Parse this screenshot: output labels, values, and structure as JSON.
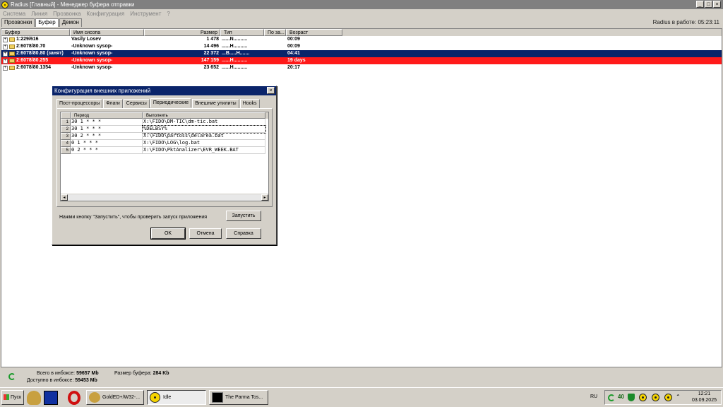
{
  "window": {
    "title": "Radius [Главный] - Менеджер буфера отправки",
    "min_label": "_",
    "max_label": "□",
    "close_label": "×"
  },
  "menu": [
    "Система",
    "Линия",
    "Прозвонка",
    "Конфигурация",
    "Инструмент",
    "?"
  ],
  "tabs": [
    "Прозвонки",
    "Буфер",
    "Демон"
  ],
  "uptime": "Radius в работе: 05:23:11",
  "table": {
    "headers": [
      "Буфер",
      "Имя сисопа",
      "Размер",
      "Тип",
      "По за...",
      "Возраст"
    ],
    "rows": [
      {
        "buffer": "1:229/616",
        "name": "Vasily Losev",
        "size": "1 478",
        "type": "......N..........",
        "age": "00:09",
        "state": "normal"
      },
      {
        "buffer": "2:6078/80.70",
        "name": "-Unknown sysop-",
        "size": "14 496",
        "type": "......H..........",
        "age": "00:09",
        "state": "normal"
      },
      {
        "buffer": "2:6078/80.80 (занят)",
        "name": "-Unknown sysop-",
        "size": "22 372",
        "type": "...B.....H.......",
        "age": "04:41",
        "state": "selected"
      },
      {
        "buffer": "2:6078/80.255",
        "name": "-Unknown sysop-",
        "size": "147 159",
        "type": "......H..........",
        "age": "19 days",
        "state": "red"
      },
      {
        "buffer": "2:6078/80.1354",
        "name": "-Unknown sysop-",
        "size": "23 652",
        "type": "......H..........",
        "age": "20:17",
        "state": "normal"
      }
    ]
  },
  "status": {
    "inbox_total_label": "Всего в инбоксе:",
    "inbox_total_value": "59657 Mb",
    "buffer_size_label": "Размер буфера:",
    "buffer_size_value": "284 Kb",
    "inbox_free_label": "Доступно в инбоксе:",
    "inbox_free_value": "59453 Mb"
  },
  "dialog": {
    "title": "Конфигурация внешних приложений",
    "close_label": "×",
    "tabs": [
      "Пост-процессоры",
      "Флаги",
      "Сервисы",
      "Периодические",
      "Внешние утилиты",
      "Hooks"
    ],
    "active_tab": "Периодические",
    "grid_headers": [
      "Период",
      "Выполнить"
    ],
    "grid_rows": [
      {
        "n": "1",
        "period": "30 1 * * *",
        "exec": "X:\\FIDO\\DM-TIC\\dm-tic.bat"
      },
      {
        "n": "2",
        "period": "30 1 * * *",
        "exec": "%DELBSY%"
      },
      {
        "n": "3",
        "period": "30 2 * * *",
        "exec": "X:\\FIDO\\partoss\\delarea.bat"
      },
      {
        "n": "4",
        "period": "0 1 * * *",
        "exec": "X:\\FIDO\\LOG\\log.bat"
      },
      {
        "n": "5",
        "period": "0 2 * * *",
        "exec": "X:\\FIDO\\PktAnalizer\\EVR_WEEK.BAT"
      }
    ],
    "scroll_left": "◂",
    "scroll_right": "▸",
    "hint": "Нажми кнопку \"Запустить\", чтобы проверить запуск приложения",
    "run_button": "Запустить",
    "ok_button": "OK",
    "cancel_button": "Отмена",
    "help_button": "Справка"
  },
  "taskbar": {
    "start_label": "Пуск",
    "tasks": [
      "GoldED+/W32-...",
      "Idle",
      "The Parma Tos..."
    ],
    "lang": "RU",
    "tray_count": "40",
    "time": "12:21",
    "date": "03.09.2025"
  },
  "colors": {
    "selected_row": "#0a246a",
    "alert_row": "#ff1a1a",
    "title_active": "#0a246a"
  },
  "icons": [
    "radiation-icon",
    "folder-icon",
    "expand-icon",
    "refresh-icon",
    "opera-icon",
    "shield-icon"
  ]
}
